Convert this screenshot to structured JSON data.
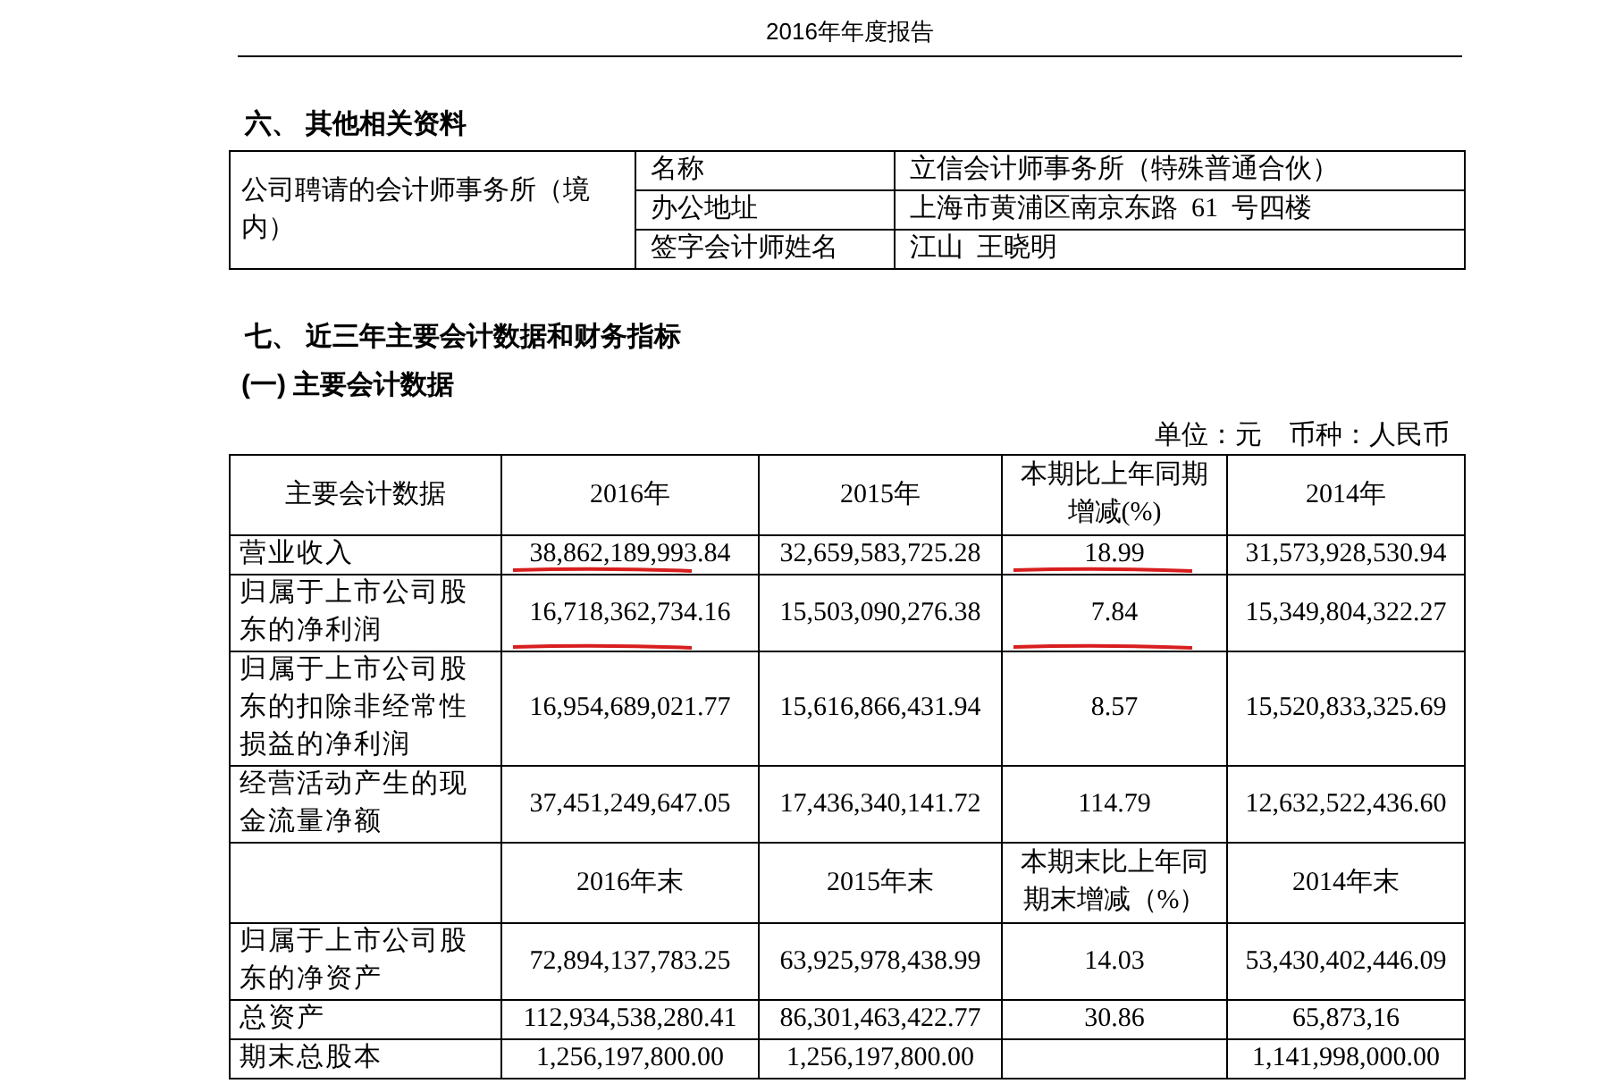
{
  "page_header": "2016年年度报告",
  "section_6": {
    "heading": "六、 其他相关资料",
    "table": {
      "label": "公司聘请的会计师事务所（境内）",
      "rows": [
        {
          "field": "名称",
          "value": "立信会计师事务所（特殊普通合伙）"
        },
        {
          "field": "办公地址",
          "value": "上海市黄浦区南京东路  61  号四楼"
        },
        {
          "field": "签字会计师姓名",
          "value": "江山  王晓明"
        }
      ]
    }
  },
  "section_7": {
    "heading": "七、 近三年主要会计数据和财务指标",
    "subheading": "(一) 主要会计数据",
    "unit_note": "单位：元    币种：人民币",
    "table": {
      "rows": [
        {
          "kind": "header",
          "cells": [
            "主要会计数据",
            "2016年",
            "2015年",
            "本期比上年同期增减(%)",
            "2014年"
          ]
        },
        {
          "kind": "data",
          "cells": [
            "营业收入",
            "38,862,189,993.84",
            "32,659,583,725.28",
            "18.99",
            "31,573,928,530.94"
          ],
          "red_underline": [
            false,
            true,
            false,
            true,
            false
          ]
        },
        {
          "kind": "data",
          "cells": [
            "归属于上市公司股东的净利润",
            "16,718,362,734.16",
            "15,503,090,276.38",
            "7.84",
            "15,349,804,322.27"
          ],
          "red_underline": [
            false,
            true,
            false,
            true,
            false
          ]
        },
        {
          "kind": "data",
          "cells": [
            "归属于上市公司股东的扣除非经常性损益的净利润",
            "16,954,689,021.77",
            "15,616,866,431.94",
            "8.57",
            "15,520,833,325.69"
          ],
          "red_underline": [
            false,
            false,
            false,
            false,
            false
          ]
        },
        {
          "kind": "data",
          "cells": [
            "经营活动产生的现金流量净额",
            "37,451,249,647.05",
            "17,436,340,141.72",
            "114.79",
            "12,632,522,436.60"
          ],
          "red_underline": [
            false,
            false,
            false,
            false,
            false
          ]
        },
        {
          "kind": "header",
          "cells": [
            null,
            "2016年末",
            "2015年末",
            "本期末比上年同期末增减（%）",
            "2014年末"
          ]
        },
        {
          "kind": "data",
          "cells": [
            "归属于上市公司股东的净资产",
            "72,894,137,783.25",
            "63,925,978,438.99",
            "14.03",
            "53,430,402,446.09"
          ],
          "red_underline": [
            false,
            false,
            false,
            false,
            false
          ]
        },
        {
          "kind": "data",
          "cells": [
            "总资产",
            "112,934,538,280.41",
            "86,301,463,422.77",
            "30.86",
            "65,873,16"
          ],
          "red_underline": [
            false,
            false,
            false,
            false,
            false
          ]
        },
        {
          "kind": "data",
          "cells": [
            "期末总股本",
            "1,256,197,800.00",
            "1,256,197,800.00",
            null,
            "1,141,998,000.00"
          ],
          "red_underline": [
            false,
            false,
            false,
            false,
            false
          ]
        }
      ]
    }
  }
}
